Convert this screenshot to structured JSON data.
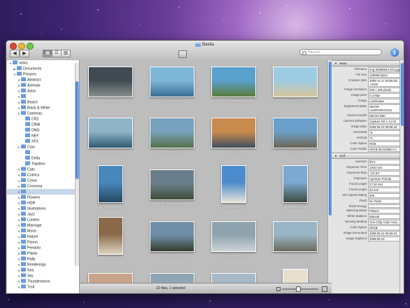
{
  "window": {
    "title": "Bastia"
  },
  "search": {
    "placeholder": "Search"
  },
  "sidebar": {
    "items": [
      {
        "label": "mirko",
        "indent": 0,
        "tri": "▼"
      },
      {
        "label": "Documents",
        "indent": 1,
        "tri": "▶"
      },
      {
        "label": "Pictures",
        "indent": 1,
        "tri": "▼"
      },
      {
        "label": "Abstract",
        "indent": 2,
        "tri": "▼"
      },
      {
        "label": "Animals",
        "indent": 2,
        "tri": "▼"
      },
      {
        "label": "Astro",
        "indent": 2,
        "tri": "▼"
      },
      {
        "label": "",
        "indent": 2,
        "tri": "▼"
      },
      {
        "label": "Beach",
        "indent": 2,
        "tri": "▼"
      },
      {
        "label": "Black & White",
        "indent": 2,
        "tri": "▼"
      },
      {
        "label": "Cameras",
        "indent": 2,
        "tri": "▼"
      },
      {
        "label": "CR2",
        "indent": 3,
        "tri": ""
      },
      {
        "label": "CRW",
        "indent": 3,
        "tri": ""
      },
      {
        "label": "DNG",
        "indent": 3,
        "tri": ""
      },
      {
        "label": "NEF",
        "indent": 3,
        "tri": ""
      },
      {
        "label": "XF3",
        "indent": 3,
        "tri": ""
      },
      {
        "label": "Cars",
        "indent": 2,
        "tri": "▼"
      },
      {
        "label": "",
        "indent": 3,
        "tri": ""
      },
      {
        "label": "Delta",
        "indent": 3,
        "tri": ""
      },
      {
        "label": "Topolino",
        "indent": 3,
        "tri": ""
      },
      {
        "label": "Cats",
        "indent": 2,
        "tri": "▼"
      },
      {
        "label": "Comics",
        "indent": 2,
        "tri": "▼"
      },
      {
        "label": "Corse",
        "indent": 2,
        "tri": "▼"
      },
      {
        "label": "Cremona",
        "indent": 2,
        "tri": "▼"
      },
      {
        "label": "",
        "indent": 2,
        "tri": "▼",
        "selected": true
      },
      {
        "label": "Flowers",
        "indent": 2,
        "tri": "▼"
      },
      {
        "label": "HDR",
        "indent": 2,
        "tri": "▼"
      },
      {
        "label": "Illustrations",
        "indent": 2,
        "tri": "▼"
      },
      {
        "label": "Jazz",
        "indent": 2,
        "tri": "▼"
      },
      {
        "label": "London",
        "indent": 2,
        "tri": "▼"
      },
      {
        "label": "Marriage",
        "indent": 2,
        "tri": "▼"
      },
      {
        "label": "Moon",
        "indent": 2,
        "tri": "▼"
      },
      {
        "label": "Nature",
        "indent": 2,
        "tri": "▼"
      },
      {
        "label": "Panos",
        "indent": 2,
        "tri": "▼"
      },
      {
        "label": "Pendolo",
        "indent": 2,
        "tri": "▼"
      },
      {
        "label": "Plants",
        "indent": 2,
        "tri": "▼"
      },
      {
        "label": "Rally",
        "indent": 2,
        "tri": "▼"
      },
      {
        "label": "Renderings",
        "indent": 2,
        "tri": "▼"
      },
      {
        "label": "Sea",
        "indent": 2,
        "tri": "▼"
      },
      {
        "label": "Sky",
        "indent": 2,
        "tri": "▼"
      },
      {
        "label": "Thunderstorm",
        "indent": 2,
        "tri": "▼"
      },
      {
        "label": "Troll",
        "indent": 2,
        "tri": "▼"
      }
    ]
  },
  "thumbnails": [
    {
      "caption": "222_Ptoliha",
      "colors": [
        "#3f4a52",
        "#8b8f8e"
      ],
      "orient": "land"
    },
    {
      "caption": "Img-20090511-044",
      "colors": [
        "#7fb7d8",
        "#3a6e96"
      ],
      "orient": "land"
    },
    {
      "caption": "Img-20090511-058",
      "colors": [
        "#5aa0cc",
        "#5b7e3a"
      ],
      "orient": "land"
    },
    {
      "caption": "Img-20080523-101",
      "colors": [
        "#9ccbe2",
        "#d8c49a"
      ],
      "orient": "land"
    },
    {
      "caption": "Img-20090926-235",
      "colors": [
        "#8fb4c8",
        "#2f5a72"
      ],
      "orient": "land"
    },
    {
      "caption": "Img-20090926-117",
      "colors": [
        "#78a2bd",
        "#557048"
      ],
      "orient": "land"
    },
    {
      "caption": "_DSC8112",
      "colors": [
        "#c88b4d",
        "#3f4e5f"
      ],
      "orient": "land"
    },
    {
      "caption": "_DSC3955",
      "colors": [
        "#6aa0c9",
        "#6e6450"
      ],
      "orient": "land"
    },
    {
      "caption": "Img-20090511-063",
      "colors": [
        "#4a87bd",
        "#24485e"
      ],
      "orient": "port"
    },
    {
      "caption": "Img-20090926-241",
      "colors": [
        "#6a7d8a",
        "#3f4f3a"
      ],
      "orient": "land"
    },
    {
      "caption": "Img-20090511-057",
      "colors": [
        "#4c8ccc",
        "#e6e2d6"
      ],
      "orient": "port"
    },
    {
      "caption": "Img-20090511-047",
      "colors": [
        "#7ba9d1",
        "#3d4a3e"
      ],
      "orient": "port"
    },
    {
      "caption": "_DSC6027",
      "colors": [
        "#8a6a4a",
        "#ddd3c1"
      ],
      "orient": "port"
    },
    {
      "caption": "Img-20090926-243",
      "colors": [
        "#6e8fa7",
        "#343b2d"
      ],
      "orient": "land"
    },
    {
      "caption": "Img-20090526-181",
      "colors": [
        "#8fa3ae",
        "#cdd4d6"
      ],
      "orient": "land"
    },
    {
      "caption": "Img-20090926-150",
      "colors": [
        "#99b4c4",
        "#6a6a5c"
      ],
      "orient": "land"
    },
    {
      "caption": "",
      "colors": [
        "#c9a48a",
        "#5a3f30"
      ],
      "orient": "land"
    },
    {
      "caption": "",
      "colors": [
        "#8fa6b4",
        "#61544a"
      ],
      "orient": "land"
    },
    {
      "caption": "",
      "colors": [
        "#a7b9c6",
        "#7a6b58"
      ],
      "orient": "land"
    },
    {
      "caption": "",
      "colors": [
        "#e8ded0",
        "#b49a7e"
      ],
      "orient": "port"
    }
  ],
  "status": {
    "text": "22 files, 1 selected"
  },
  "inspector": {
    "main_section": "Main",
    "main_rows": [
      {
        "k": "Filename",
        "v": "Img-20080523-101.jpg"
      },
      {
        "k": "File size",
        "v": "128066 bytes"
      },
      {
        "k": "Creation date",
        "v": "2009-11-17 00:06:35 +0100"
      },
      {
        "k": "Image resolution",
        "v": "640 x 426 pixels"
      },
      {
        "k": "Image pixel",
        "v": "0.3 Mpx"
      },
      {
        "k": "Image",
        "v": "Landscape"
      },
      {
        "k": "Equipment Make",
        "v": "NIKON CORPORATION"
      },
      {
        "k": "Camera Model",
        "v": "NIKON D50"
      },
      {
        "k": "Camera Software",
        "v": "Capture NX 1.3.2 M"
      },
      {
        "k": "Image Date",
        "v": "2008:05:23 09:08:19"
      },
      {
        "k": "Horizontal",
        "v": "72"
      },
      {
        "k": "Vertical",
        "v": "72"
      },
      {
        "k": "Color Space",
        "v": "RGB"
      },
      {
        "k": "Color Profile",
        "v": "sRGB IEC61966-2.1"
      }
    ],
    "exif_section": "Exif",
    "exif_rows": [
      {
        "k": "Aperture",
        "v": "f/8.0"
      },
      {
        "k": "Exposure Time",
        "v": "1/640 sec"
      },
      {
        "k": "Exposure Bias",
        "v": "-1/3 EV"
      },
      {
        "k": "Exposure",
        "v": "Aperture Priority"
      },
      {
        "k": "Focal Length",
        "v": "27.00 mm"
      },
      {
        "k": "Focal Length",
        "v": "40 mm"
      },
      {
        "k": "ISO Speed Rating",
        "v": "200"
      },
      {
        "k": "Flash",
        "v": "No Flash"
      },
      {
        "k": "Flash Energy",
        "v": ""
      },
      {
        "k": "Metering Mode",
        "v": "Pattern"
      },
      {
        "k": "White Balance",
        "v": "Manual"
      },
      {
        "k": "Sensing Method",
        "v": "One-Chip Color Area"
      },
      {
        "k": "Color Space",
        "v": "sRGB"
      },
      {
        "k": "Image Generated",
        "v": "2008:05:23 09:08:19"
      },
      {
        "k": "Image Digitized",
        "v": "2008:05:23"
      }
    ]
  },
  "toolbar": {
    "back_label": "◀",
    "forward_label": "▶",
    "view_icons": "▦",
    "view_list": "☷",
    "view_columns": "▥",
    "info_label": "i"
  }
}
